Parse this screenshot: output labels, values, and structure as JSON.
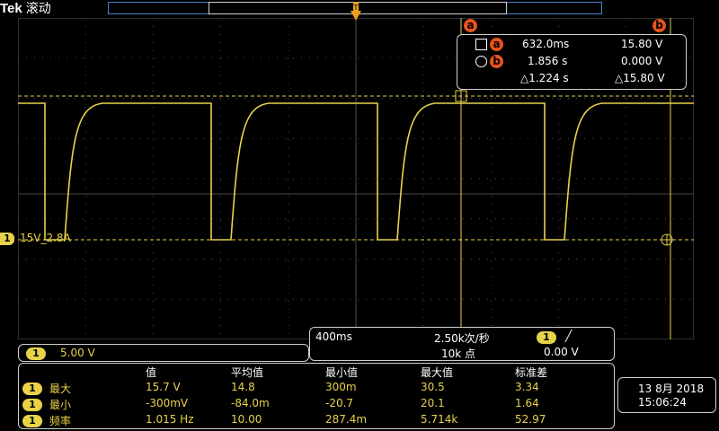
{
  "header": {
    "brand": "Tek",
    "mode": "滚动"
  },
  "cursors": {
    "a_label": "a",
    "b_label": "b",
    "row_a": {
      "time": "632.0ms",
      "volt": "15.80 V"
    },
    "row_b": {
      "time": "1.856 s",
      "volt": "0.000 V"
    },
    "delta": {
      "time": "△1.224 s",
      "volt": "△15.80 V"
    }
  },
  "channel": {
    "number": "1",
    "label": "15V_2.8A",
    "scale": "5.00 V"
  },
  "acquisition": {
    "timebase": "400ms",
    "sample_rate": "2.50k次/秒",
    "record_length": "10k 点",
    "trigger_level": "0.00 V",
    "trigger_slope": "╱"
  },
  "measurements": {
    "headers": [
      "值",
      "平均值",
      "最小值",
      "最大值",
      "标准差"
    ],
    "rows": [
      {
        "ch": "1",
        "name": "最大",
        "values": [
          "15.7 V",
          "14.8",
          "300m",
          "30.5",
          "3.34"
        ]
      },
      {
        "ch": "1",
        "name": "最小",
        "values": [
          "-300mV",
          "-84.0m",
          "-20.7",
          "20.1",
          "1.64"
        ]
      },
      {
        "ch": "1",
        "name": "频率",
        "values": [
          "1.015 Hz",
          "10.00",
          "287.4m",
          "5.714k",
          "52.97"
        ]
      }
    ]
  },
  "datetime": {
    "date": "13 8月 2018",
    "time": "15:06:24"
  },
  "colors": {
    "trace": "#e8d24a",
    "cursor": "#e8531c",
    "grid": "#5a5a5a"
  }
}
